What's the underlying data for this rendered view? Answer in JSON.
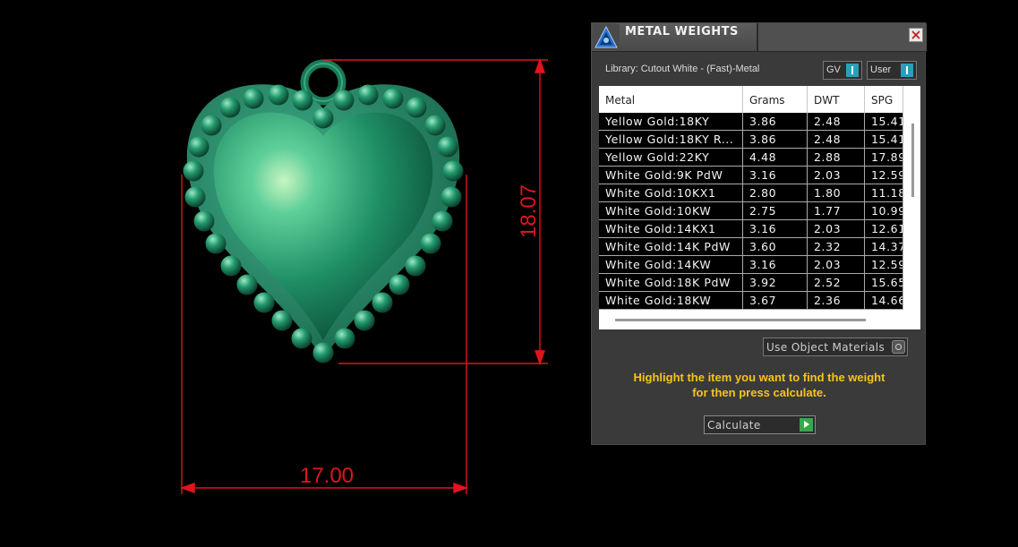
{
  "viewport": {
    "dimension_width": "17.00",
    "dimension_height": "18.07",
    "dimension_color": "#e0141c",
    "pendant_color": "#2a9a70"
  },
  "panel": {
    "title": "METAL WEIGHTS",
    "library": "Library: Cutout White - (Fast)-Metal",
    "gv_label": "GV",
    "user_label": "User",
    "columns": [
      "Metal",
      "Grams",
      "DWT",
      "SPG"
    ],
    "rows": [
      {
        "metal": "Yellow Gold:18KY",
        "grams": "3.86",
        "dwt": "2.48",
        "spg": "15.41"
      },
      {
        "metal": "Yellow Gold:18KY R...",
        "grams": "3.86",
        "dwt": "2.48",
        "spg": "15.41"
      },
      {
        "metal": "Yellow Gold:22KY",
        "grams": "4.48",
        "dwt": "2.88",
        "spg": "17.89"
      },
      {
        "metal": "White Gold:9K PdW",
        "grams": "3.16",
        "dwt": "2.03",
        "spg": "12.59"
      },
      {
        "metal": "White Gold:10KX1",
        "grams": "2.80",
        "dwt": "1.80",
        "spg": "11.18"
      },
      {
        "metal": "White Gold:10KW",
        "grams": "2.75",
        "dwt": "1.77",
        "spg": "10.99"
      },
      {
        "metal": "White Gold:14KX1",
        "grams": "3.16",
        "dwt": "2.03",
        "spg": "12.61"
      },
      {
        "metal": "White Gold:14K PdW",
        "grams": "3.60",
        "dwt": "2.32",
        "spg": "14.37"
      },
      {
        "metal": "White Gold:14KW",
        "grams": "3.16",
        "dwt": "2.03",
        "spg": "12.59"
      },
      {
        "metal": "White Gold:18K PdW",
        "grams": "3.92",
        "dwt": "2.52",
        "spg": "15.65"
      },
      {
        "metal": "White Gold:18KW",
        "grams": "3.67",
        "dwt": "2.36",
        "spg": "14.66"
      }
    ],
    "material_option": "Use Object Materials",
    "instructions_line1": "Highlight the item you want to find the weight",
    "instructions_line2": "for then press calculate.",
    "calculate_label": "Calculate",
    "instruction_color": "#f5c518"
  }
}
